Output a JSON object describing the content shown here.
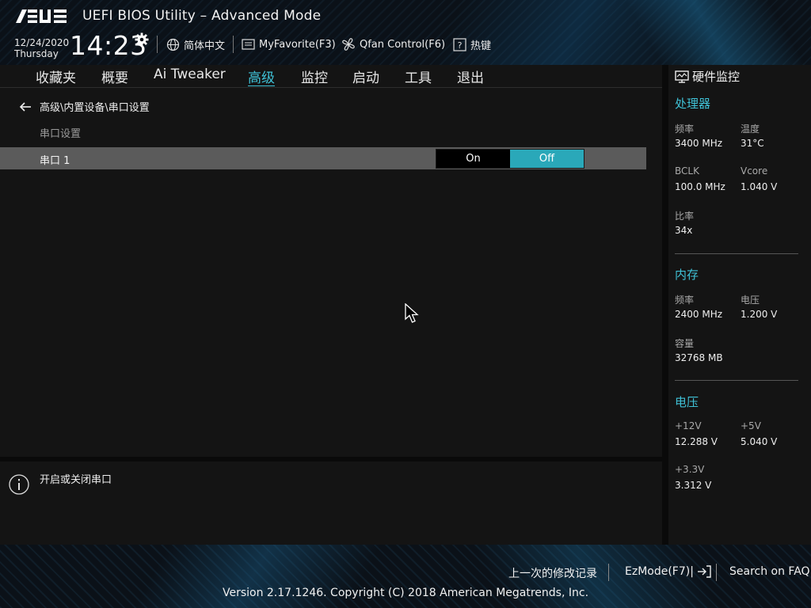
{
  "header": {
    "brand": "ASUS",
    "title": "UEFI BIOS Utility – Advanced Mode",
    "date": "12/24/2020",
    "weekday": "Thursday",
    "time": "14:23",
    "language": "简体中文",
    "myfavorite": "MyFavorite(F3)",
    "qfan": "Qfan Control(F6)",
    "hotkeys": "热键"
  },
  "nav": {
    "tabs": [
      {
        "label": "收藏夹"
      },
      {
        "label": "概要"
      },
      {
        "label": "Ai Tweaker"
      },
      {
        "label": "高级",
        "active": true
      },
      {
        "label": "监控"
      },
      {
        "label": "启动"
      },
      {
        "label": "工具"
      },
      {
        "label": "退出"
      }
    ]
  },
  "main": {
    "breadcrumb": "高级\\内置设备\\串口设置",
    "section_label": "串口设置",
    "setting": {
      "label": "串口 1",
      "options": [
        "On",
        "Off"
      ],
      "selected": "Off"
    }
  },
  "help": {
    "text": "开启或关闭串口"
  },
  "monitor": {
    "title": "硬件监控",
    "cpu": {
      "heading": "处理器",
      "freq_label": "频率",
      "freq": "3400 MHz",
      "temp_label": "温度",
      "temp": "31°C",
      "bclk_label": "BCLK",
      "bclk": "100.0 MHz",
      "vcore_label": "Vcore",
      "vcore": "1.040 V",
      "ratio_label": "比率",
      "ratio": "34x"
    },
    "memory": {
      "heading": "内存",
      "freq_label": "频率",
      "freq": "2400 MHz",
      "volt_label": "电压",
      "volt": "1.200 V",
      "cap_label": "容量",
      "cap": "32768 MB"
    },
    "voltage": {
      "heading": "电压",
      "v12_label": "+12V",
      "v12": "12.288 V",
      "v5_label": "+5V",
      "v5": "5.040 V",
      "v33_label": "+3.3V",
      "v33": "3.312 V"
    }
  },
  "footer": {
    "last_changes": "上一次的修改记录",
    "ezmode": "EzMode(F7)|",
    "faq": "Search on FAQ",
    "copyright": "Version 2.17.1246. Copyright (C) 2018 American Megatrends, Inc."
  },
  "colors": {
    "accent": "#3fc1d6",
    "toggle_selected": "#2aa8b9",
    "row_highlight": "#5b5b5b"
  }
}
